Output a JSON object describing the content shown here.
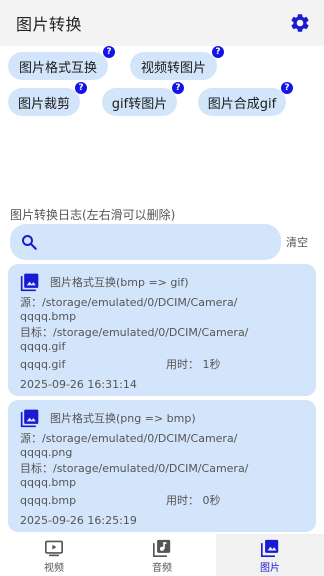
{
  "app": {
    "title": "图片转换"
  },
  "features": [
    {
      "label": "图片格式互换",
      "help": "?"
    },
    {
      "label": "视频转图片",
      "help": "?"
    },
    {
      "label": "图片裁剪",
      "help": "?"
    },
    {
      "label": "gif转图片",
      "help": "?"
    },
    {
      "label": "图片合成gif",
      "help": "?"
    }
  ],
  "log": {
    "title": "图片转换日志(左右滑可以删除)",
    "search_placeholder": "",
    "clear_label": "清空",
    "entries": [
      {
        "operation": "图片格式互换(bmp => gif)",
        "source_label": "源：",
        "source_path": "/storage/emulated/0/DCIM/Camera/",
        "source_file": "qqqq.bmp",
        "target_label": "目标：",
        "target_path": "/storage/emulated/0/DCIM/Camera/",
        "target_file": "qqqq.gif",
        "output_name": "qqqq.gif",
        "duration": "用时：  1秒",
        "timestamp": "2025-09-26 16:31:14"
      },
      {
        "operation": "图片格式互换(png => bmp)",
        "source_label": "源：",
        "source_path": "/storage/emulated/0/DCIM/Camera/",
        "source_file": "qqqq.png",
        "target_label": "目标：",
        "target_path": "/storage/emulated/0/DCIM/Camera/",
        "target_file": "qqqq.bmp",
        "output_name": "qqqq.bmp",
        "duration": "用时：  0秒",
        "timestamp": "2025-09-26 16:25:19"
      }
    ]
  },
  "nav": {
    "items": [
      {
        "label": "视频",
        "icon": "video-icon",
        "active": false
      },
      {
        "label": "音频",
        "icon": "music-icon",
        "active": false
      },
      {
        "label": "图片",
        "icon": "image-icon",
        "active": true
      }
    ]
  },
  "colors": {
    "accent": "#1a1ad1",
    "chip_bg": "#d3e5fb",
    "badge": "#1414e6",
    "app_bar": "#f3f3f3"
  }
}
